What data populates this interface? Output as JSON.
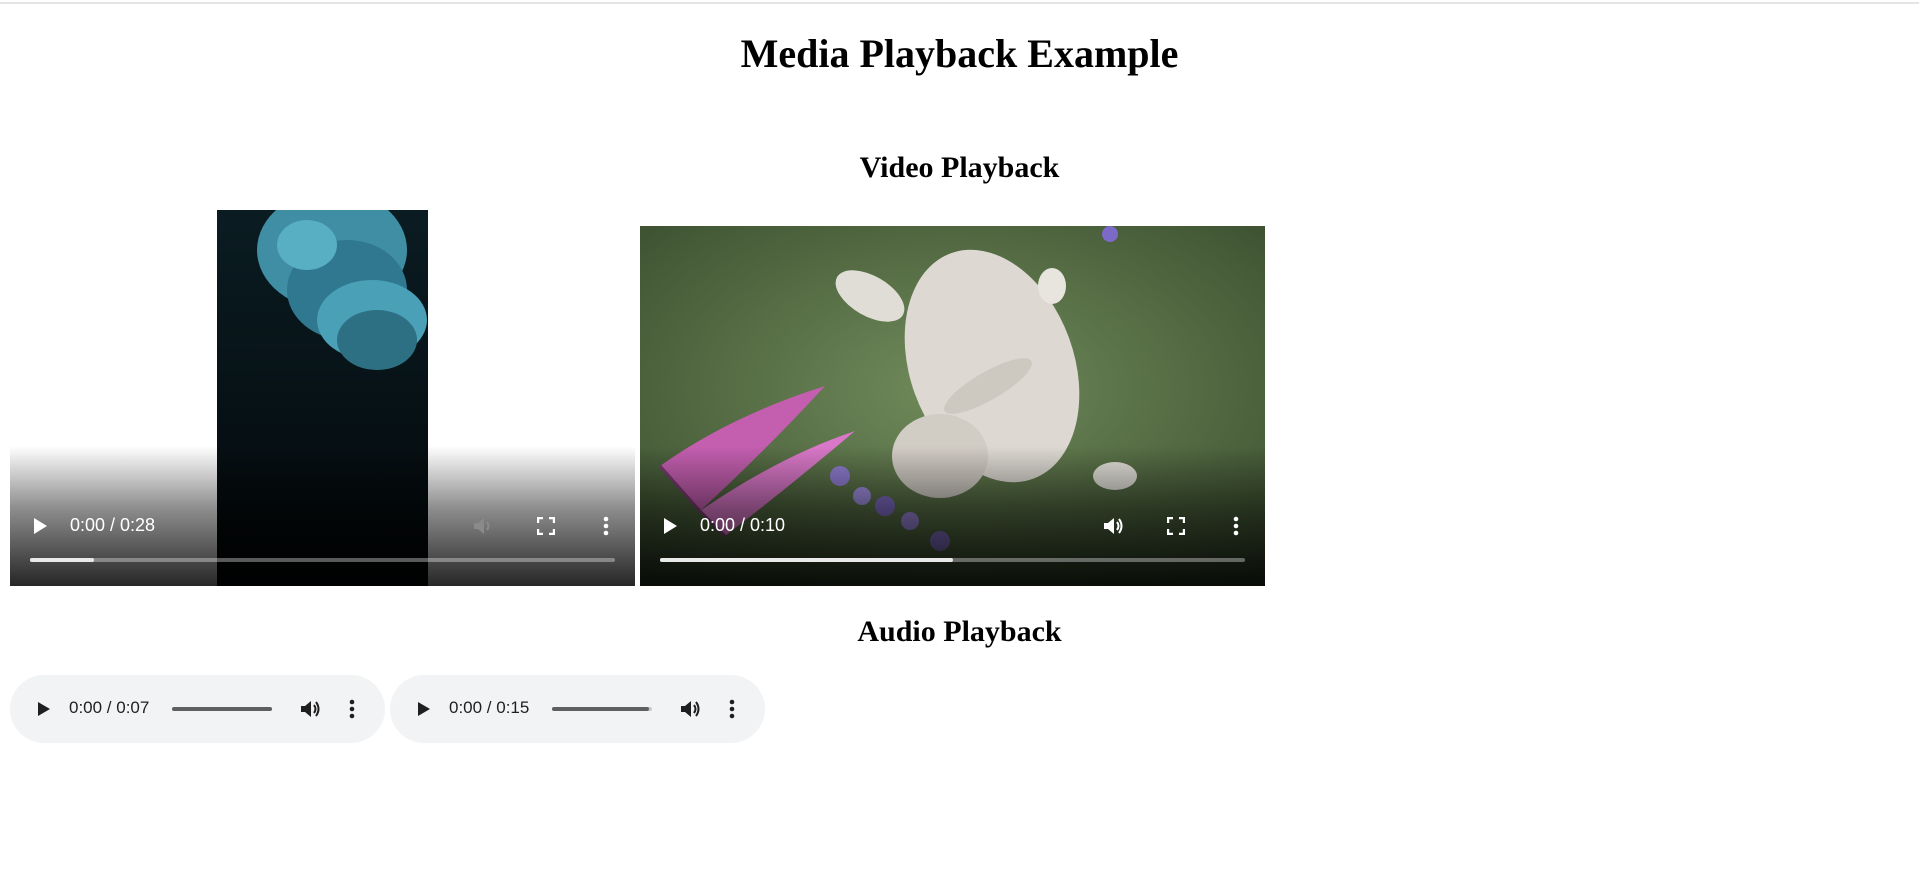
{
  "page": {
    "title": "Media Playback Example",
    "video_heading": "Video Playback",
    "audio_heading": "Audio Playback"
  },
  "videos": [
    {
      "time": "0:00 / 0:28",
      "progress": 0.11,
      "volume_muted": true
    },
    {
      "time": "0:00 / 0:10",
      "progress": 0.5,
      "volume_muted": false
    }
  ],
  "audios": [
    {
      "time": "0:00 / 0:07",
      "volume_level": 1.0
    },
    {
      "time": "0:00 / 0:15",
      "volume_level": 0.97
    }
  ],
  "icons": {
    "play": "play-icon",
    "volume": "volume-icon",
    "fullscreen": "fullscreen-icon",
    "more": "more-options-icon"
  },
  "colors": {
    "audio_bg": "#f1f3f4",
    "control_fg": "#ffffff"
  }
}
